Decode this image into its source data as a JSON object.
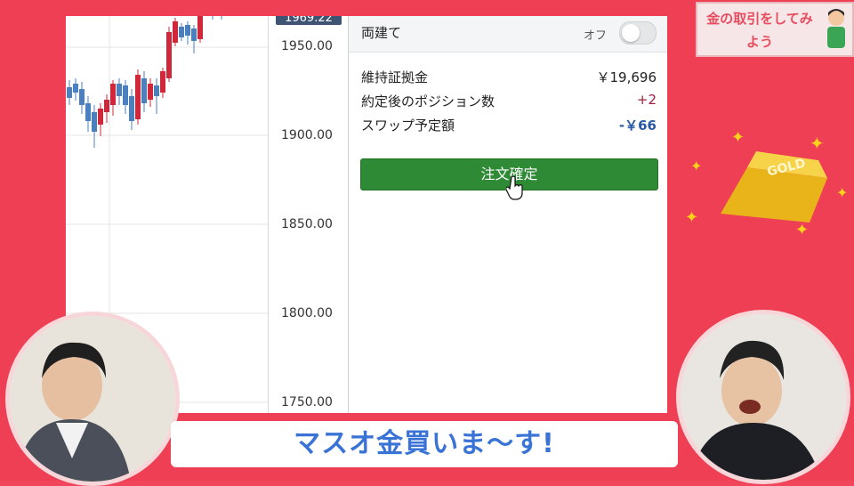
{
  "axis": {
    "top_tag": "1969.22",
    "labels": [
      "1950.00",
      "1900.00",
      "1850.00",
      "1800.00",
      "1750.00"
    ]
  },
  "panel": {
    "title": "両建て",
    "toggle_label": "オフ",
    "rows": [
      {
        "label": "維持証拠金",
        "value": "￥19,696",
        "color": "#222222"
      },
      {
        "label": "約定後のポジション数",
        "value": "+2",
        "color": "#a01d3e"
      },
      {
        "label": "スワップ予定額",
        "value": "-￥66",
        "color": "#2b5aa5"
      }
    ],
    "confirm_button": "注文確定"
  },
  "banner": {
    "text": "マスオ金買いま〜す!"
  },
  "topic": {
    "text": "金の取引をしてみよう"
  },
  "gold_bar": {
    "label": "GOLD"
  },
  "colors": {
    "frame": "#ee3f55",
    "button": "#2f8a36",
    "up_candle": "#d0283a",
    "down_candle": "#4a7fc0"
  }
}
